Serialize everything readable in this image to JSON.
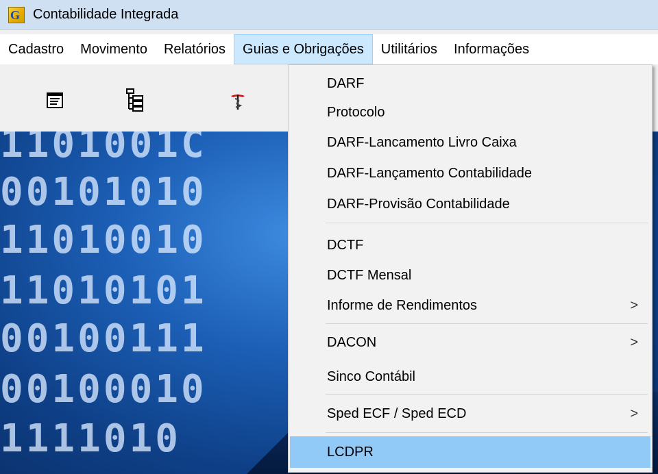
{
  "window": {
    "title": "Contabilidade Integrada",
    "icon": "app-g-icon"
  },
  "menubar": {
    "items": [
      "Cadastro",
      "Movimento",
      "Relatórios",
      "Guias e Obrigações",
      "Utilitários",
      "Informações"
    ],
    "active": "Guias e Obrigações"
  },
  "toolbar": {
    "icons": [
      "form-icon",
      "tree-icon",
      "medical-icon"
    ]
  },
  "background": {
    "rows": [
      "1101001C",
      "00101010",
      "11010010",
      "11010101",
      "00100111",
      "00100010",
      "1111010"
    ]
  },
  "dropdown": {
    "items": [
      {
        "label": "DARF"
      },
      {
        "label": "Protocolo"
      },
      {
        "label": "DARF-Lancamento Livro Caixa"
      },
      {
        "label": "DARF-Lançamento Contabilidade"
      },
      {
        "label": "DARF-Provisão Contabilidade"
      },
      {
        "label": "DCTF"
      },
      {
        "label": "DCTF Mensal"
      },
      {
        "label": "Informe de Rendimentos",
        "submenu": ">"
      },
      {
        "label": "DACON",
        "submenu": ">"
      },
      {
        "label": "Sinco Contábil"
      },
      {
        "label": "Sped ECF / Sped ECD",
        "submenu": ">"
      },
      {
        "label": "LCDPR",
        "highlighted": true
      }
    ]
  },
  "colors": {
    "menu_highlight": "#91c9f7",
    "active_menu": "#cce8ff",
    "titlebar": "#cfe0f3"
  }
}
